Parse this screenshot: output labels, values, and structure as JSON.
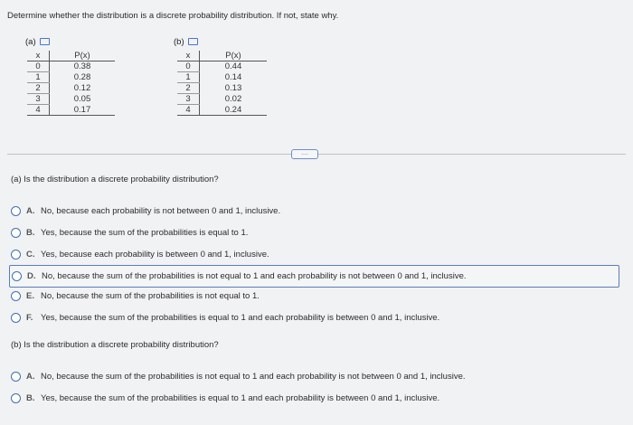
{
  "question": "Determine whether the distribution is a discrete probability distribution. If not, state why.",
  "tables": [
    {
      "label": "(a)",
      "headers": [
        "x",
        "P(x)"
      ],
      "rows": [
        [
          "0",
          "0.38"
        ],
        [
          "1",
          "0.28"
        ],
        [
          "2",
          "0.12"
        ],
        [
          "3",
          "0.05"
        ],
        [
          "4",
          "0.17"
        ]
      ]
    },
    {
      "label": "(b)",
      "headers": [
        "x",
        "P(x)"
      ],
      "rows": [
        [
          "0",
          "0.44"
        ],
        [
          "1",
          "0.14"
        ],
        [
          "2",
          "0.13"
        ],
        [
          "3",
          "0.02"
        ],
        [
          "4",
          "0.24"
        ]
      ]
    }
  ],
  "more_button": "....",
  "part_a": {
    "prompt": "(a) Is the distribution a discrete probability distribution?",
    "options": [
      {
        "letter": "A.",
        "text": "No, because each probability is not between 0 and 1, inclusive."
      },
      {
        "letter": "B.",
        "text": "Yes, because the sum of the probabilities is equal to 1."
      },
      {
        "letter": "C.",
        "text": "Yes, because each probability is between 0 and 1, inclusive."
      },
      {
        "letter": "D.",
        "text": "No, because the sum of the probabilities is not equal to 1 and each probability is not between 0 and 1, inclusive."
      },
      {
        "letter": "E.",
        "text": "No, because the sum of the probabilities is not equal to 1."
      },
      {
        "letter": "F.",
        "text": "Yes, because the sum of the probabilities is equal to 1 and each probability is between 0 and 1, inclusive."
      }
    ]
  },
  "part_b": {
    "prompt": "(b) Is the distribution a discrete probability distribution?",
    "options": [
      {
        "letter": "A.",
        "text": "No, because the sum of the probabilities is not equal to 1 and each probability is not between 0 and 1, inclusive."
      },
      {
        "letter": "B.",
        "text": "Yes, because the sum of the probabilities is equal to 1 and each probability is between 0 and 1, inclusive."
      }
    ]
  }
}
